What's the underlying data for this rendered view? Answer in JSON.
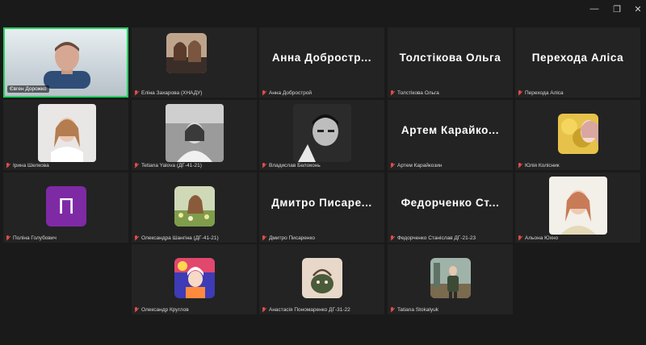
{
  "window": {
    "minimize": "—",
    "restore": "❐",
    "close": "✕"
  },
  "colors": {
    "tile_bg": "#232323",
    "active_border": "#23d160",
    "muted_mic": "#e34c4c",
    "letter_avatar": "#7e2aa5"
  },
  "active_speaker": {
    "label": "Євген Дорожко"
  },
  "participants": [
    {
      "name": "Еліна Захарова (ХНАДУ)",
      "big": "",
      "avatar": "photo-two-women"
    },
    {
      "name": "Анна Добрострой",
      "big": "Анна  Добростр...",
      "avatar": ""
    },
    {
      "name": "Толстікова Ольга",
      "big": "Толстікова  Ольга",
      "avatar": ""
    },
    {
      "name": "Перехода Аліса",
      "big": "Перехода  Аліса",
      "avatar": ""
    },
    {
      "name": "Ірина Шелкова",
      "big": "",
      "avatar": "photo-woman"
    },
    {
      "name": "Tetiana Yalova (ДГ-41-21)",
      "big": "",
      "avatar": "photo-bw"
    },
    {
      "name": "Владислав Белоконь",
      "big": "",
      "avatar": "photo-bw-man"
    },
    {
      "name": "Артем Карайкозин",
      "big": "Артем  Карайко...",
      "avatar": ""
    },
    {
      "name": "Юлія Колісник",
      "big": "",
      "avatar": "photo-yellow"
    },
    {
      "name": "Поліна Голубович",
      "big": "",
      "avatar": "letter",
      "letter": "П"
    },
    {
      "name": "Олександра Шангіна (ДГ-41-21)",
      "big": "",
      "avatar": "photo-flowers"
    },
    {
      "name": "Дмитро Писаренко",
      "big": "Дмитро  Писаре...",
      "avatar": ""
    },
    {
      "name": "Федорченко Станіслав ДГ-21-23",
      "big": "Федорченко  Ст...",
      "avatar": ""
    },
    {
      "name": "Альона Юхно",
      "big": "",
      "avatar": "photo-woman-light"
    },
    {
      "name": "Олександр Круглов",
      "big": "",
      "avatar": "photo-colorful"
    },
    {
      "name": "Анастасія Пономаренко ДГ-31-22",
      "big": "",
      "avatar": "photo-green-bag"
    },
    {
      "name": "Tatiana Stokalyuk",
      "big": "",
      "avatar": "photo-outdoor"
    }
  ]
}
